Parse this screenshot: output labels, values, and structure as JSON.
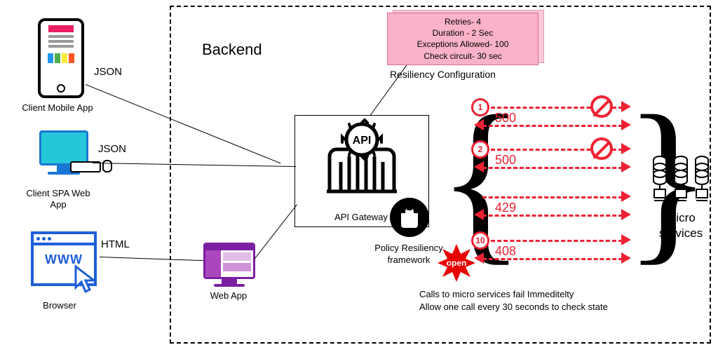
{
  "clients": {
    "mobile": "Client Mobile App",
    "spa": "Client SPA Web\nApp",
    "browser": "Browser",
    "webapp": "Web App"
  },
  "protocols": {
    "json1": "JSON",
    "json2": "JSON",
    "html": "HTML"
  },
  "backend_title": "Backend",
  "gateway_label": "API Gateway",
  "resiliency_config_title": "Resiliency Configuration",
  "resiliency_config": {
    "retries": "Retries- 4",
    "duration": "Duration - 2 Sec",
    "exceptions": "Exceptions Allowed- 100",
    "check": "Check circuit- 30 sec"
  },
  "policy_label": "Policy Resiliency\nframework",
  "circuit_state": "open",
  "arrows": {
    "badge1": "1",
    "badge2": "2",
    "badge10": "10",
    "code1": "500",
    "code2": "500",
    "code3": "429",
    "code4": "408"
  },
  "fail_text": {
    "line1": "Calls to micro services fail Immeditelty",
    "line2": "Allow one call every 30 seconds to check state"
  },
  "micro_label": "Micro\nservices"
}
